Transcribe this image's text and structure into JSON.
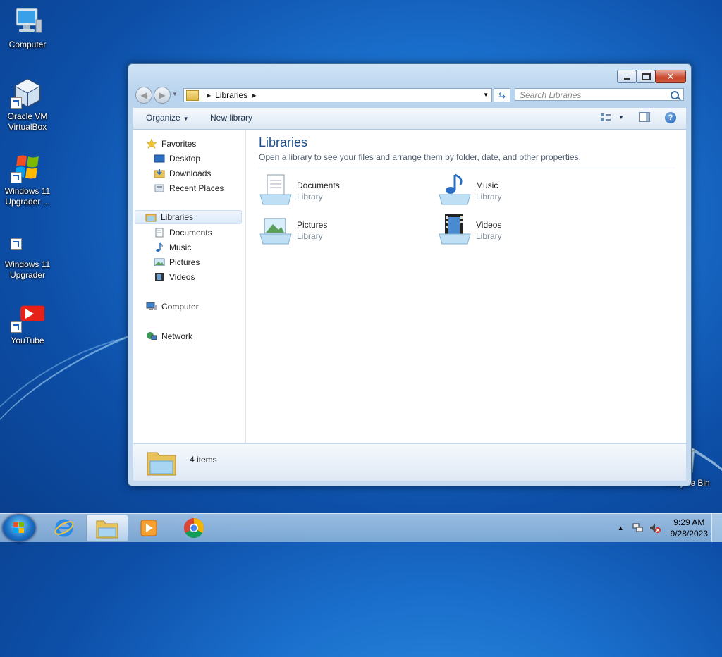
{
  "desktop": {
    "icons": [
      {
        "label": "Computer"
      },
      {
        "label": "Oracle VM VirtualBox"
      },
      {
        "label": "Windows 11 Upgrader ..."
      },
      {
        "label": "Windows 11 Upgrader"
      },
      {
        "label": "YouTube"
      },
      {
        "label": "Recycle Bin"
      }
    ]
  },
  "window": {
    "address": {
      "segment": "Libraries"
    },
    "search_placeholder": "Search Libraries",
    "toolbar": {
      "organize": "Organize",
      "new_library": "New library"
    },
    "nav": {
      "favorites": {
        "label": "Favorites",
        "items": [
          "Desktop",
          "Downloads",
          "Recent Places"
        ]
      },
      "libraries": {
        "label": "Libraries",
        "items": [
          "Documents",
          "Music",
          "Pictures",
          "Videos"
        ]
      },
      "computer": "Computer",
      "network": "Network"
    },
    "content": {
      "title": "Libraries",
      "subtitle": "Open a library to see your files and arrange them by folder, date, and other properties.",
      "libraries": [
        {
          "name": "Documents",
          "type": "Library"
        },
        {
          "name": "Music",
          "type": "Library"
        },
        {
          "name": "Pictures",
          "type": "Library"
        },
        {
          "name": "Videos",
          "type": "Library"
        }
      ]
    },
    "details": {
      "count": "4 items"
    }
  },
  "taskbar": {
    "clock": {
      "time": "9:29 AM",
      "date": "9/28/2023"
    }
  }
}
